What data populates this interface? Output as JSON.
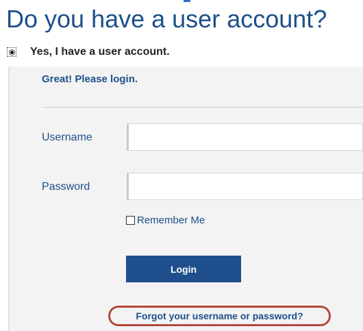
{
  "header": {
    "title": "Do you have a user account?"
  },
  "account_choice": {
    "selected_label": "Yes, I have a user account.",
    "selected": true
  },
  "login_panel": {
    "greeting": "Great! Please login.",
    "username": {
      "label": "Username",
      "value": ""
    },
    "password": {
      "label": "Password",
      "value": ""
    },
    "remember_me": {
      "label": "Remember Me",
      "checked": false
    },
    "login_button_label": "Login",
    "forgot_link": "Forgot your username or password?"
  },
  "colors": {
    "brand_blue": "#1f4f8d",
    "panel_background": "#f3f3f3",
    "highlight_ring": "#b5473c"
  }
}
